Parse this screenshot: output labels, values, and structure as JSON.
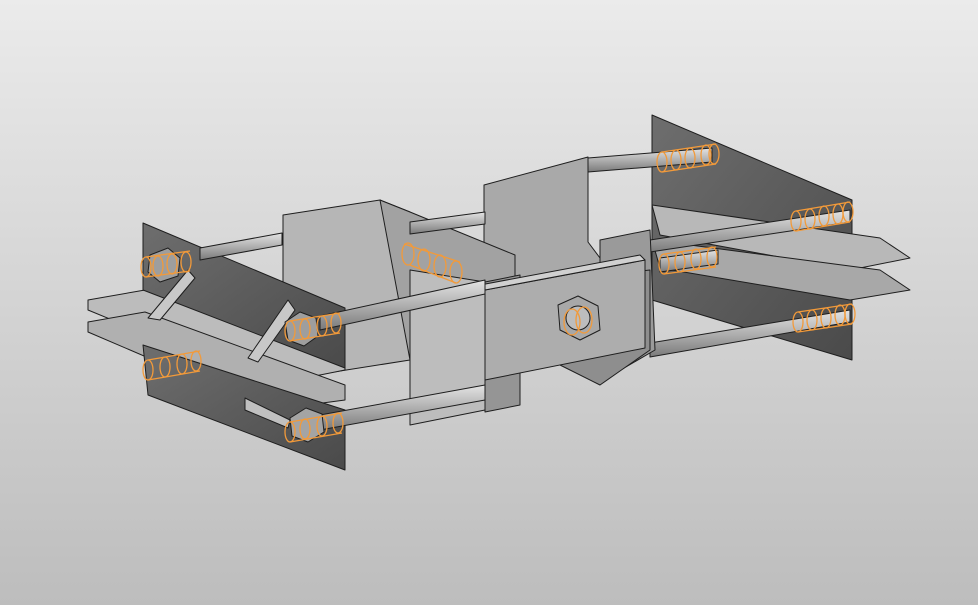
{
  "viewport": {
    "name": "3d-model-viewport",
    "background_top": "#ebebeb",
    "background_bottom": "#bdbdbd"
  },
  "model": {
    "name": "pipe-clamp-bracket-assembly",
    "plate_light": "#c4c4c4",
    "plate_mid": "#9c9c9c",
    "plate_dark": "#5e5e5e",
    "edge_color": "#1e1e1e",
    "thread_highlight": "#f29a3a"
  }
}
